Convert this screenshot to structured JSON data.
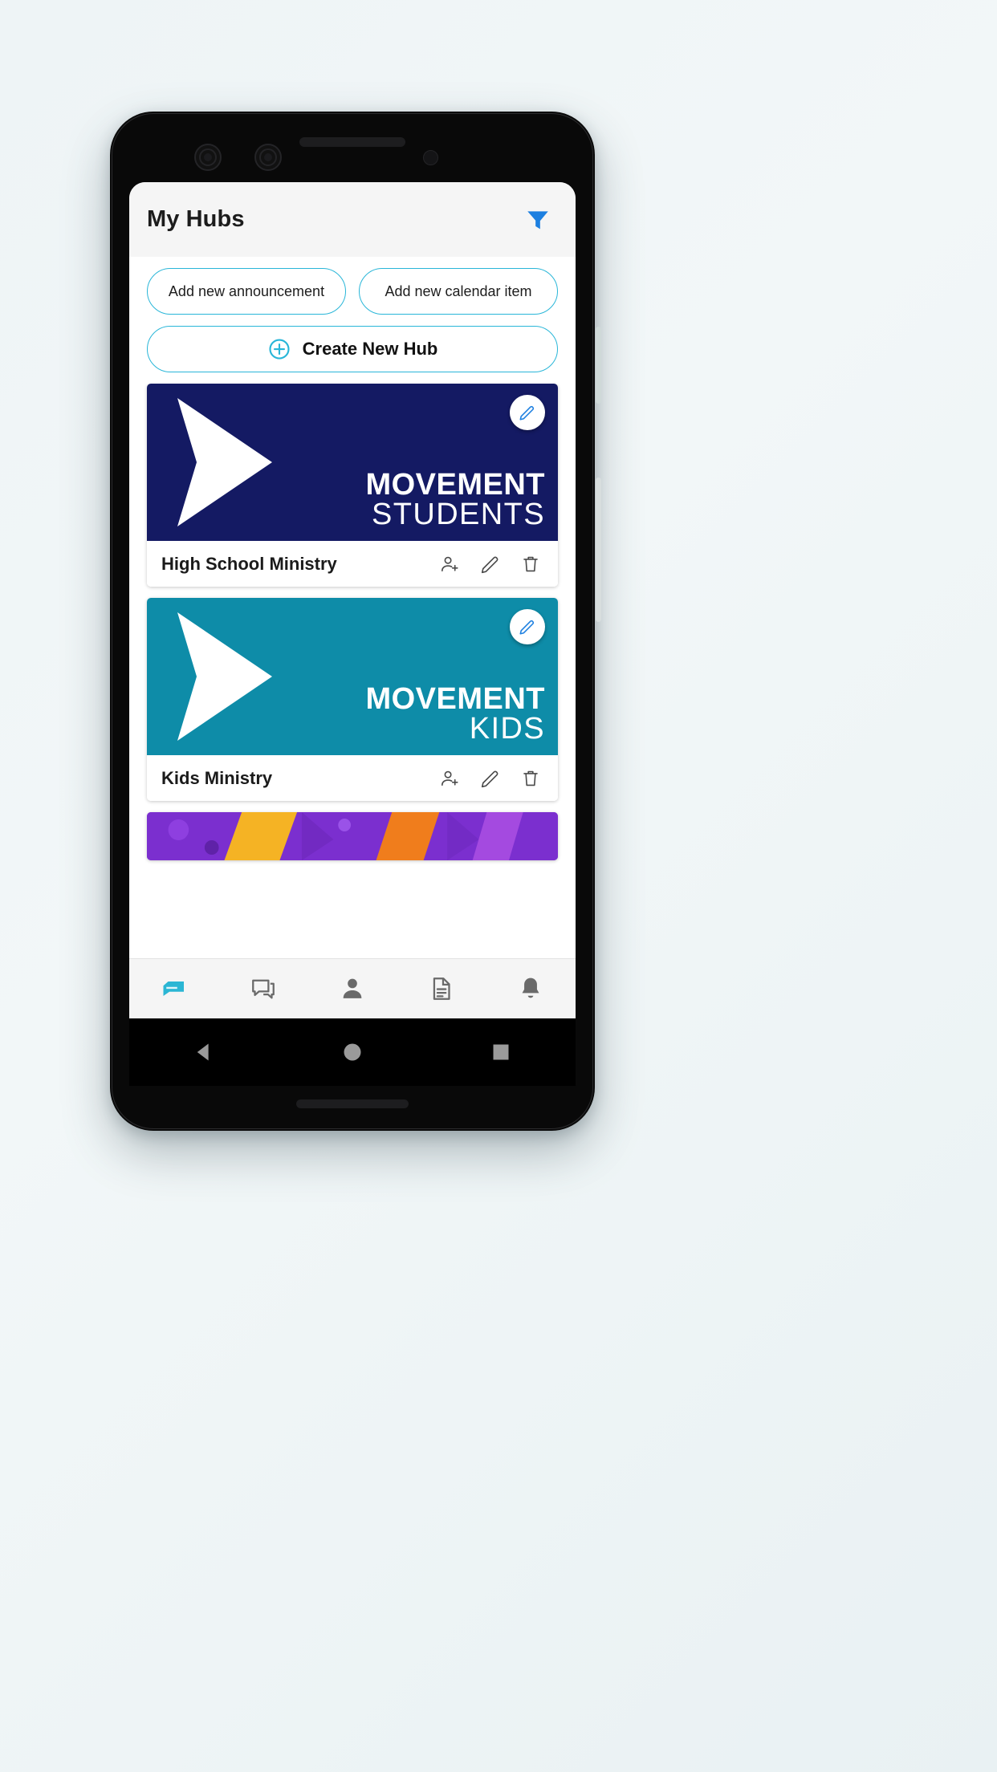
{
  "app": {
    "header": {
      "title": "My Hubs",
      "filter_icon": "filter-icon",
      "accent_color": "#1c7fe0"
    },
    "quick_actions": [
      {
        "label": "Add new announcement",
        "name": "add-new-announcement-button"
      },
      {
        "label": "Add new calendar item",
        "name": "add-new-calendar-item-button"
      }
    ],
    "create_hub": {
      "label": "Create New Hub",
      "icon": "plus-circle-icon",
      "border_color": "#29b6d8"
    },
    "hubs": [
      {
        "name": "High School Ministry",
        "banner_line1": "MOVEMENT",
        "banner_line2": "STUDENTS",
        "banner_color": "#141a63",
        "edit_fab_icon": "pencil-icon",
        "actions": [
          "add-person-icon",
          "pencil-icon",
          "trash-icon"
        ]
      },
      {
        "name": "Kids Ministry",
        "banner_line1": "MOVEMENT",
        "banner_line2": "KIDS",
        "banner_color": "#0e8ca8",
        "edit_fab_icon": "pencil-icon",
        "actions": [
          "add-person-icon",
          "pencil-icon",
          "trash-icon"
        ]
      },
      {
        "name": "",
        "banner_line1": "",
        "banner_line2": "",
        "banner_color": "#7b2fcf",
        "edit_fab_icon": "pencil-icon",
        "actions": []
      }
    ],
    "bottom_nav": [
      {
        "icon": "hub-icon",
        "name": "nav-hubs",
        "active": true
      },
      {
        "icon": "chat-icon",
        "name": "nav-messages",
        "active": false
      },
      {
        "icon": "person-icon",
        "name": "nav-profile",
        "active": false
      },
      {
        "icon": "document-icon",
        "name": "nav-documents",
        "active": false
      },
      {
        "icon": "bell-icon",
        "name": "nav-notifications",
        "active": false
      }
    ],
    "android_nav": [
      {
        "icon": "back-triangle-icon",
        "name": "android-back"
      },
      {
        "icon": "home-circle-icon",
        "name": "android-home"
      },
      {
        "icon": "recents-square-icon",
        "name": "android-recents"
      }
    ]
  }
}
